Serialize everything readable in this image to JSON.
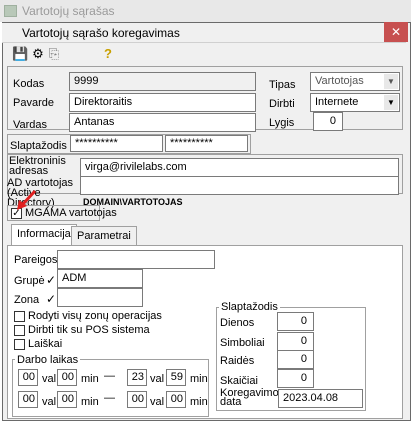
{
  "background_window": {
    "title": "Vartotojų sąrašas"
  },
  "dialog": {
    "title": "Vartotojų sąrašo koregavimas",
    "close": "✕"
  },
  "toolbar": {
    "save_icon": "💾",
    "props_icon": "⚙",
    "copy_icon": "⎘",
    "help_icon": "?"
  },
  "form": {
    "kodas_label": "Kodas",
    "kodas_value": "9999",
    "pavarde_label": "Pavarde",
    "pavarde_value": "Direktoraitis",
    "vardas_label": "Vardas",
    "vardas_value": "Antanas",
    "tipas_label": "Tipas",
    "tipas_value": "Vartotojas",
    "dirbti_label": "Dirbti",
    "dirbti_value": "Internete",
    "lygis_label": "Lygis",
    "lygis_value": "0",
    "slaptazodis_label": "Slaptažodis",
    "password1": "**********",
    "password2": "**********",
    "email_label": "Elektroninis adresas",
    "email_value": "virga@rivilelabs.com",
    "ad_label": "AD vartotojas (Active Directory)",
    "ad_value": "",
    "ad_hint": "DOMAIN\\VARTOTOJAS",
    "mgama_label": "MGAMA vartotojas",
    "mgama_checked": "✓"
  },
  "tabs": [
    {
      "label": "Informacija"
    },
    {
      "label": "Parametrai"
    }
  ],
  "info": {
    "pareigos_label": "Pareigos",
    "pareigos_value": "",
    "grupe_label": "Grupė",
    "grupe_value": "ADM",
    "zona_label": "Zona",
    "zona_value": "",
    "check_all_zones": "Rodyti visų zonų operacijas",
    "check_pos": "Dirbti tik su POS sistema",
    "check_mail": "Laiškai",
    "work_time_label": "Darbo laikas",
    "val": "val",
    "min": "min",
    "row1": {
      "h1": "00",
      "m1": "00",
      "h2": "23",
      "m2": "59"
    },
    "row2": {
      "h1": "00",
      "m1": "00",
      "h2": "00",
      "m2": "00"
    },
    "dash": "—"
  },
  "password_group": {
    "label": "Slaptažodis",
    "dienos_label": "Dienos",
    "dienos_value": "0",
    "simboliai_label": "Simboliai",
    "simboliai_value": "0",
    "raides_label": "Raidės",
    "raides_value": "0",
    "skaiciai_label": "Skaičiai",
    "skaiciai_value": "0",
    "koreg_label": "Koregavimo data",
    "koreg_value": "2023.04.08"
  },
  "colors": {
    "arrow": "#e02020",
    "icon_green": "#2e8b57",
    "close": "#c75050"
  }
}
